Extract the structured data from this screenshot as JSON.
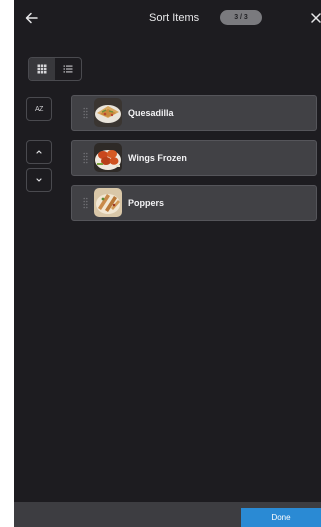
{
  "header": {
    "title": "Sort Items",
    "page_indicator": "3 / 3",
    "back_icon": "arrow-left-icon",
    "close_icon": "close-icon"
  },
  "view_toggle": {
    "options": [
      "grid-view",
      "list-view"
    ],
    "selected": "grid-view"
  },
  "sort_controls": {
    "alpha_label": "AZ",
    "move_up_icon": "chevron-up-icon",
    "move_down_icon": "chevron-down-icon"
  },
  "items": [
    {
      "label": "Quesadilla",
      "thumbnail": "quesadilla-image"
    },
    {
      "label": "Wings Frozen",
      "thumbnail": "wings-image"
    },
    {
      "label": "Poppers",
      "thumbnail": "poppers-image"
    }
  ],
  "footer": {
    "done_label": "Done"
  },
  "colors": {
    "background": "#1d1c20",
    "item_background": "#414145",
    "footer": "#3d3d41",
    "accent": "#2a8ad4"
  }
}
